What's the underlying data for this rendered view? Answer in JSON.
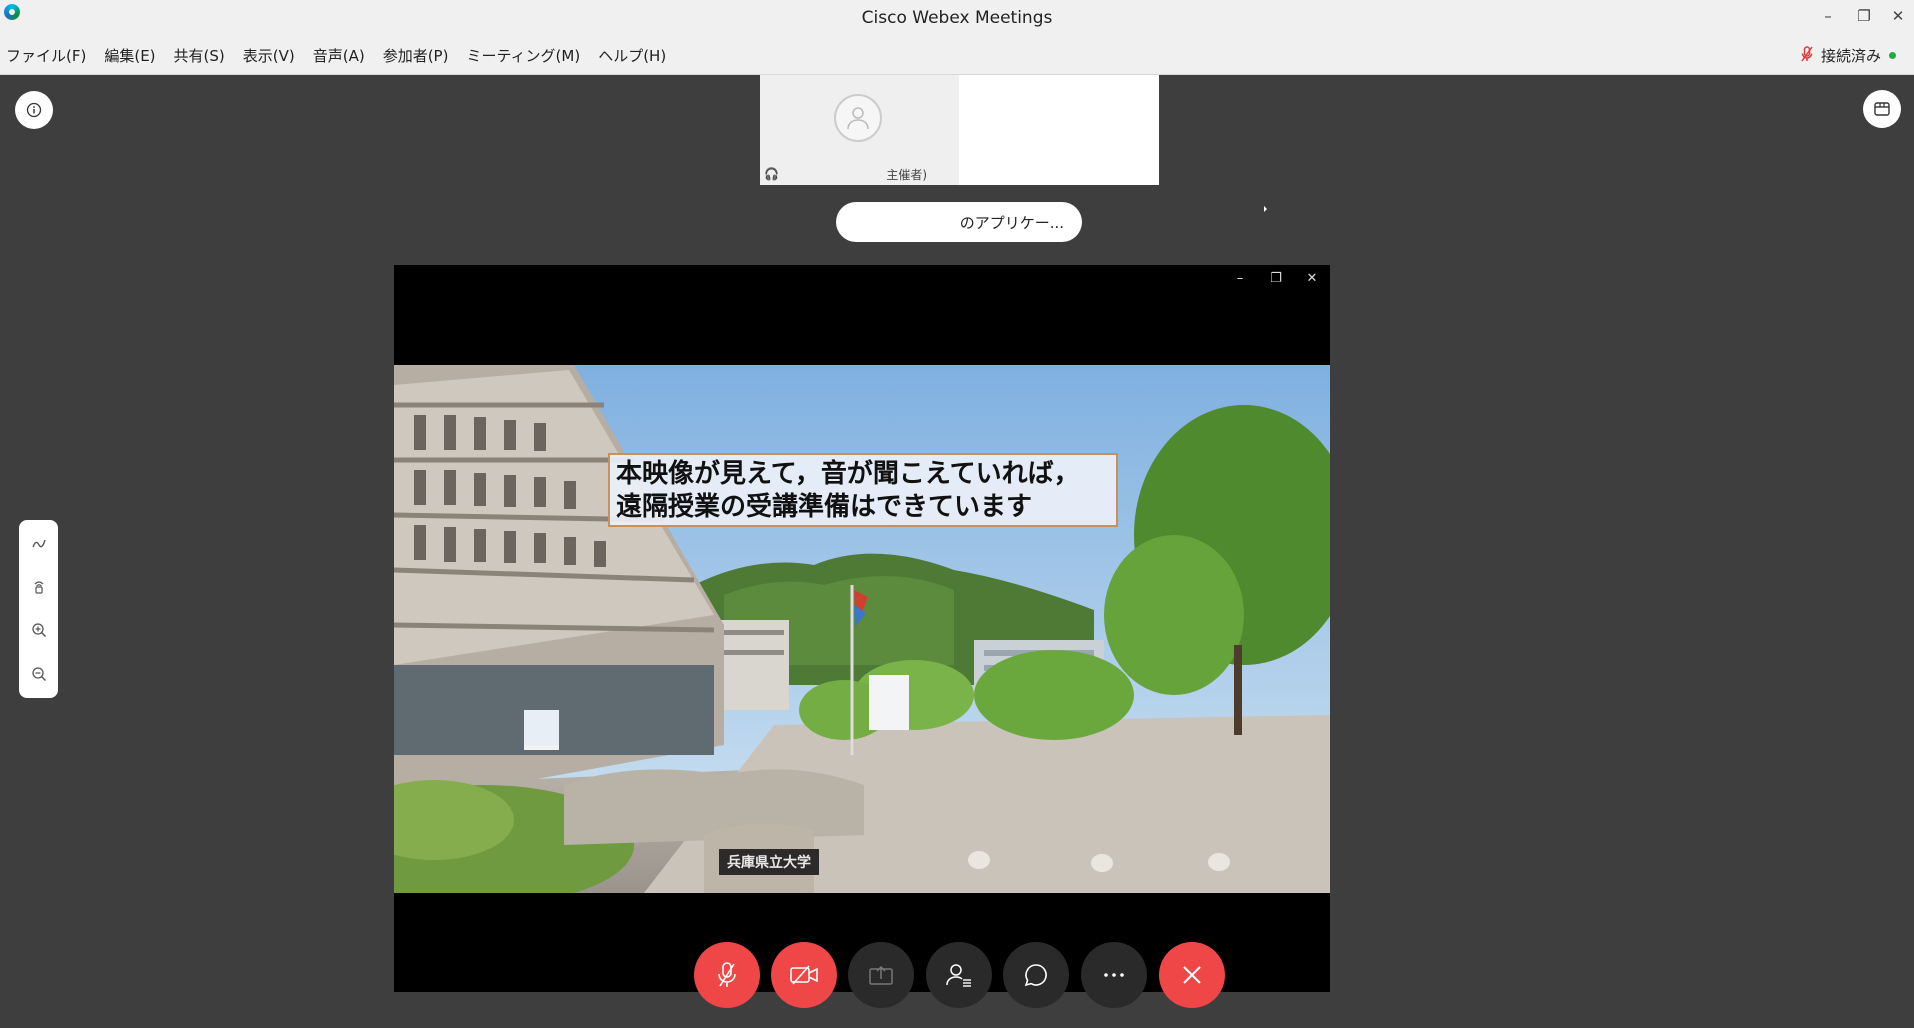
{
  "window": {
    "title": "Cisco Webex Meetings",
    "minimize": "–",
    "restore": "❐",
    "close": "✕"
  },
  "menu": [
    "ファイル(F)",
    "編集(E)",
    "共有(S)",
    "表示(V)",
    "音声(A)",
    "参加者(P)",
    "ミーティング(M)",
    "ヘルプ(H)"
  ],
  "status": {
    "label": "接続済み"
  },
  "participant": {
    "host_label": "主催者)"
  },
  "share_pill": {
    "label": "のアプリケー..."
  },
  "video_window": {
    "minimize": "–",
    "restore": "❐",
    "close": "✕",
    "caption_line1": "本映像が見えて，音が聞こえていれば，",
    "caption_line2": "遠隔授業の受講準備はできています",
    "sign_text": "兵庫県立大学"
  },
  "colors": {
    "accent_red": "#ef4748",
    "status_green": "#27a845",
    "background": "#3e3e3e"
  },
  "icons": {
    "info": "info-icon",
    "panel": "panel-icon",
    "annotate": "pen-icon",
    "hand": "hand-icon",
    "zoom_in": "zoom-in-icon",
    "zoom_out": "zoom-out-icon",
    "mute": "mic-muted-icon",
    "video": "video-off-icon",
    "share": "share-icon",
    "participants": "participants-icon",
    "chat": "chat-icon",
    "more": "more-icon",
    "leave": "leave-icon"
  }
}
